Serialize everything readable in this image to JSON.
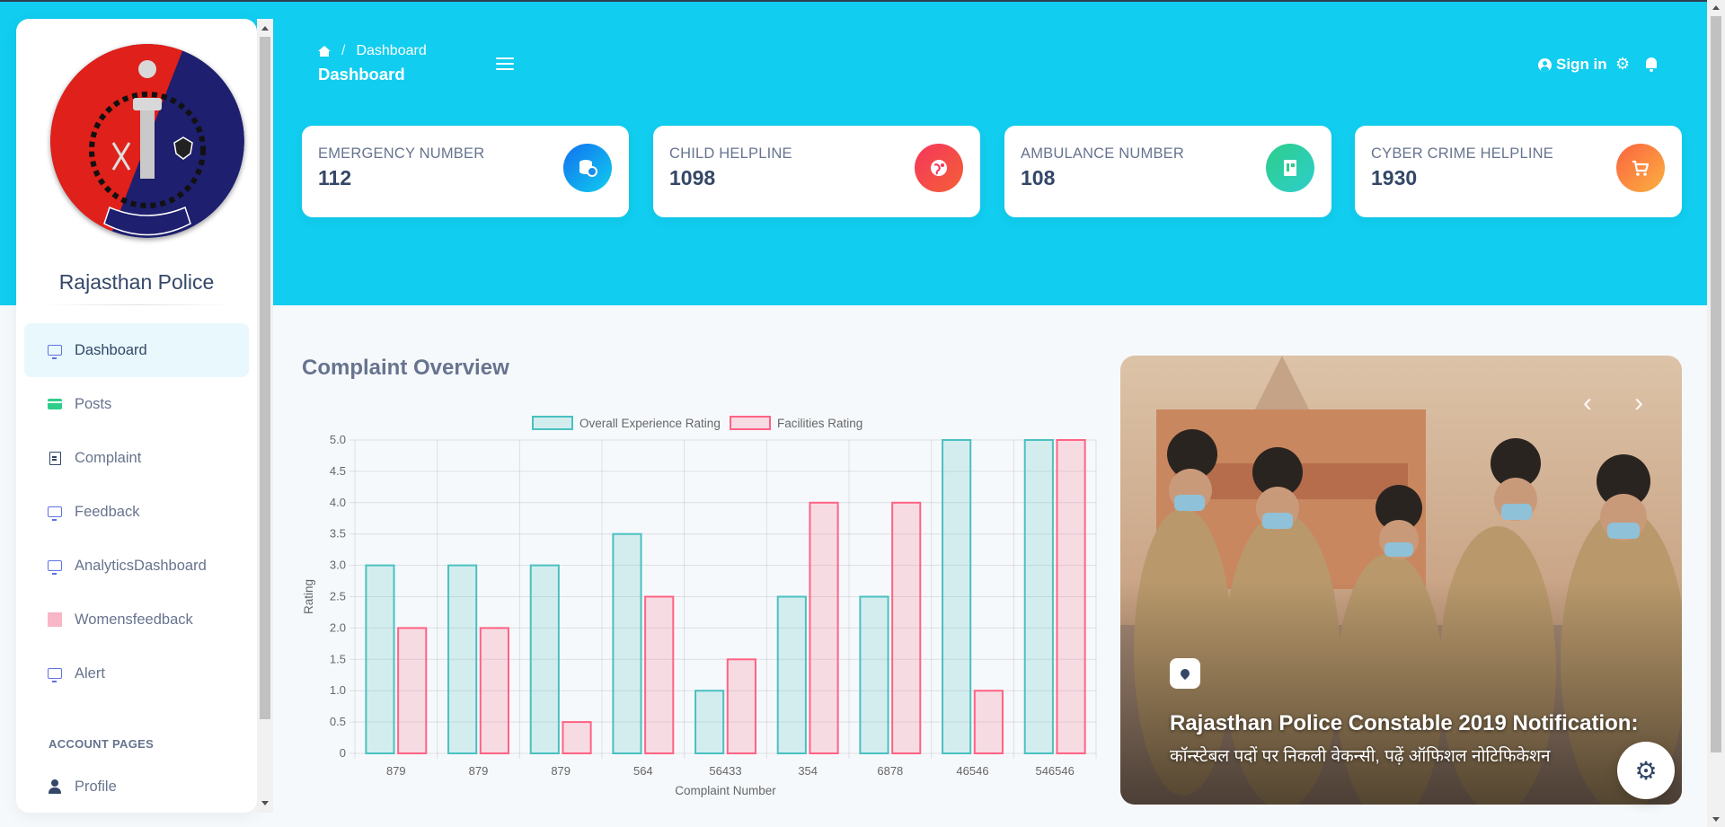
{
  "sidebar": {
    "brand": "Rajasthan Police",
    "items": [
      {
        "label": "Dashboard",
        "icon": "monitor-icon",
        "active": true
      },
      {
        "label": "Posts",
        "icon": "credit-card-icon"
      },
      {
        "label": "Complaint",
        "icon": "document-icon"
      },
      {
        "label": "Feedback",
        "icon": "monitor-icon"
      },
      {
        "label": "AnalyticsDashboard",
        "icon": "monitor-icon"
      },
      {
        "label": "Womensfeedback",
        "icon": "pink-square-icon"
      },
      {
        "label": "Alert",
        "icon": "monitor-icon"
      }
    ],
    "account_heading": "ACCOUNT PAGES",
    "profile_label": "Profile"
  },
  "header": {
    "breadcrumb": "Dashboard",
    "breadcrumb_sep": "/",
    "title": "Dashboard",
    "signin_label": "Sign in"
  },
  "cards": [
    {
      "label": "EMERGENCY NUMBER",
      "value": "112",
      "icon": "database-icon",
      "color": "#1a8ceb"
    },
    {
      "label": "CHILD HELPLINE",
      "value": "1098",
      "icon": "globe-icon",
      "color": "#f5365c"
    },
    {
      "label": "AMBULANCE NUMBER",
      "value": "108",
      "icon": "document-icon",
      "color": "#2dce89"
    },
    {
      "label": "CYBER CRIME HELPLINE",
      "value": "1930",
      "icon": "cart-icon",
      "color": "#fb6340"
    }
  ],
  "section_title": "Complaint Overview",
  "chart_data": {
    "type": "bar",
    "categories": [
      "879",
      "879",
      "879",
      "564",
      "56433",
      "354",
      "6878",
      "46546",
      "546546"
    ],
    "series": [
      {
        "name": "Overall Experience Rating",
        "values": [
          3,
          3,
          3,
          3.5,
          1,
          2.5,
          2.5,
          5,
          5
        ],
        "color": "#4bc0c0"
      },
      {
        "name": "Facilities Rating",
        "values": [
          2,
          2,
          0.5,
          2.5,
          1.5,
          4,
          4,
          1,
          5
        ],
        "color": "#ff6384"
      }
    ],
    "xlabel": "Complaint Number",
    "ylabel": "Rating",
    "ylim": [
      0,
      5
    ],
    "yticks": [
      "0",
      "0.5",
      "1.0",
      "1.5",
      "2.0",
      "2.5",
      "3.0",
      "3.5",
      "4.0",
      "4.5",
      "5.0"
    ],
    "grid": true,
    "legend": "top"
  },
  "carousel": {
    "title": "Rajasthan Police Constable 2019 Notification:",
    "subtitle": "कॉन्स्टेबल पदों पर निकली वेकन्सी, पढ़ें ऑफिशल नोटिफिकेशन",
    "prev": "‹",
    "next": "›"
  },
  "colors": {
    "header_bg": "#11cdef",
    "text_primary": "#344767",
    "text_secondary": "#67748e"
  }
}
